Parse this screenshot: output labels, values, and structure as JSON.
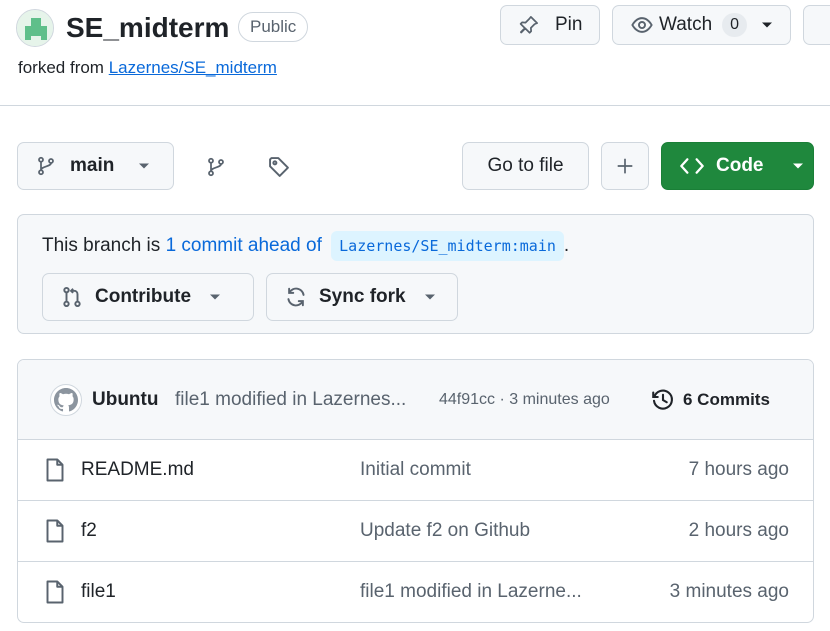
{
  "repo": {
    "name": "SE_midterm",
    "visibility": "Public",
    "forked_prefix": "forked from",
    "forked_from": "Lazernes/SE_midterm"
  },
  "actions": {
    "pin_label": "Pin",
    "watch_label": "Watch",
    "watch_count": "0"
  },
  "toolbar": {
    "branch": "main",
    "goto_file": "Go to file",
    "code_label": "Code"
  },
  "fork_status": {
    "prefix": "This branch is",
    "ahead_text": "1 commit ahead of",
    "upstream_ref": "Lazernes/SE_midterm:main",
    "suffix": ".",
    "contribute_label": "Contribute",
    "sync_label": "Sync fork"
  },
  "latest_commit": {
    "author": "Ubuntu",
    "message": "file1 modified in Lazernes...",
    "meta": "44f91cc · 3 minutes ago",
    "commits_label": "6 Commits"
  },
  "files": [
    {
      "name": "README.md",
      "commit": "Initial commit",
      "time": "7 hours ago"
    },
    {
      "name": "f2",
      "commit": "Update f2 on Github",
      "time": "2 hours ago"
    },
    {
      "name": "file1",
      "commit": "file1 modified in Lazerne...",
      "time": "3 minutes ago"
    }
  ],
  "colors": {
    "accent_link": "#0969da",
    "code_button": "#1f883d",
    "border": "#d0d7de"
  },
  "icons": [
    "repo-avatar",
    "pin-icon",
    "eye-icon",
    "chevron-down-icon",
    "branch-icon",
    "tag-icon",
    "plus-icon",
    "code-icon",
    "pull-request-icon",
    "sync-icon",
    "github-icon",
    "history-icon",
    "file-icon"
  ]
}
